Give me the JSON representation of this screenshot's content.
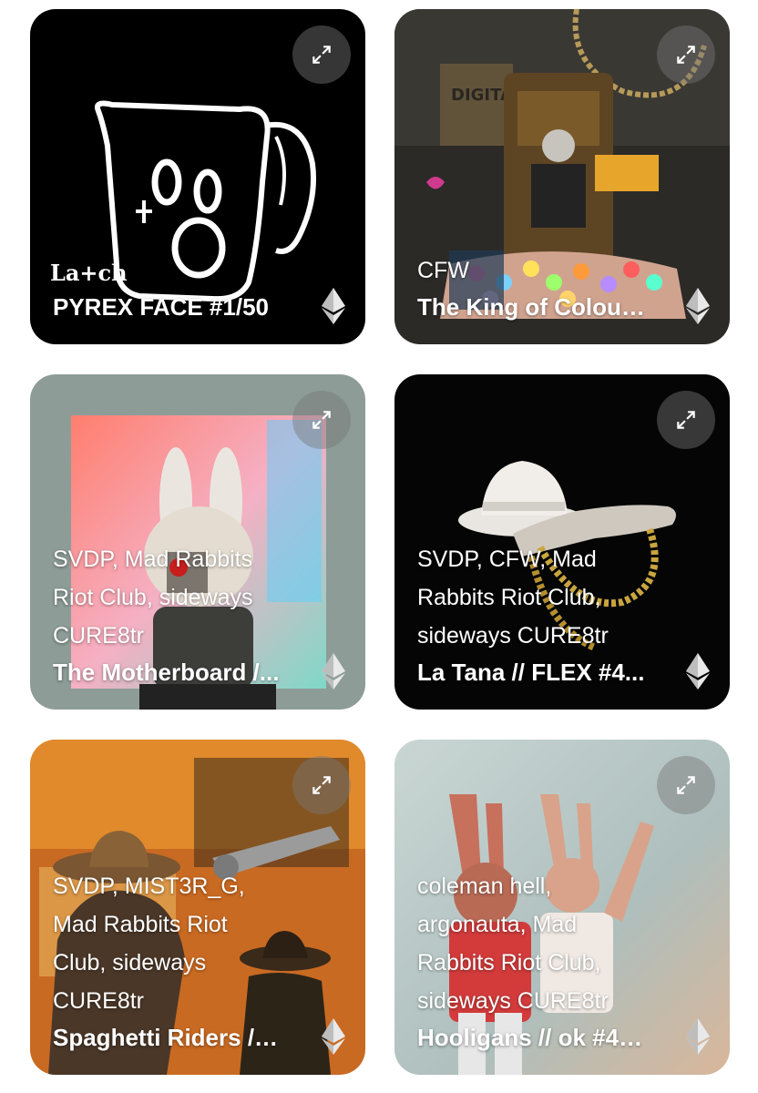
{
  "cards": [
    {
      "creators": "",
      "title": "PYREX FACE #1/50",
      "art_text": "La+ch",
      "bg": "#000000"
    },
    {
      "creators": "CFW",
      "title": "The King of Colour...",
      "art_text": "DIGITAL DRUGS",
      "bg": "#2b2a27"
    },
    {
      "creators": "SVDP, Mad Rabbits Riot Club, sideways CURE8tr",
      "title": "The Motherboard /...",
      "art_text": "",
      "bg": "#8d9c97"
    },
    {
      "creators": "SVDP, CFW, Mad Rabbits Riot Club, sideways CURE8tr",
      "title": "La Tana // FLEX #4...",
      "art_text": "",
      "bg": "#050505"
    },
    {
      "creators": "SVDP, MIST3R_G, Mad Rabbits Riot Club, sideways CURE8tr",
      "title": "Spaghetti Riders // ...",
      "art_text": "",
      "bg": "#c96a22"
    },
    {
      "creators": "coleman hell, argonauta, Mad Rabbits Riot Club, sideways CURE8tr",
      "title": "Hooligans // ok #40...",
      "art_text": "",
      "bg": "#a9bcbb"
    }
  ],
  "icons": {
    "expand": "expand-icon",
    "currency": "ethereum-icon"
  }
}
